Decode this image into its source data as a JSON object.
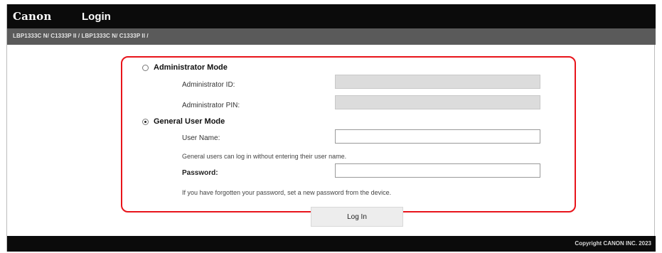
{
  "header": {
    "brand": "Canon",
    "title": "Login",
    "device_name": "LBP1333C N/ C1333P II / LBP1333C N/ C1333P II /"
  },
  "admin_mode": {
    "label": "Administrator Mode",
    "selected": false,
    "id_label": "Administrator ID:",
    "pin_label": "Administrator PIN:",
    "id_value": "",
    "pin_value": ""
  },
  "user_mode": {
    "label": "General User Mode",
    "selected": true,
    "username_label": "User Name:",
    "username_value": "",
    "username_note": "General users can log in without entering their user name.",
    "password_label": "Password:",
    "password_value": "",
    "password_note": "If you have forgotten your password, set a new password from the device."
  },
  "login_button": "Log In",
  "footer": {
    "copyright": "Copyright CANON INC. 2023"
  },
  "colors": {
    "highlight": "#e8141b",
    "topbar": "#0b0b0b",
    "subbar": "#5a5a5a"
  }
}
